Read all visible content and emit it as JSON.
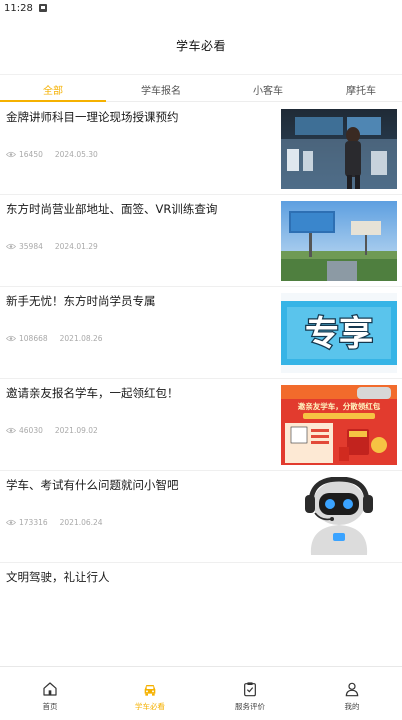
{
  "status_bar": {
    "time": "11:28"
  },
  "header": {
    "title": "学车必看"
  },
  "tabs": [
    {
      "label": "全部",
      "active": true
    },
    {
      "label": "学车报名",
      "active": false
    },
    {
      "label": "小客车",
      "active": false
    },
    {
      "label": "摩托车",
      "active": false
    }
  ],
  "articles": [
    {
      "title": "金牌讲师科目一理论现场授课预约",
      "views": "16450",
      "date": "2024.05.30",
      "thumb": "lecture-photo"
    },
    {
      "title": "东方时尚营业部地址、面签、VR训练查询",
      "views": "35984",
      "date": "2024.01.29",
      "thumb": "billboard-photo"
    },
    {
      "title": "新手无忧！东方时尚学员专属",
      "views": "108668",
      "date": "2021.08.26",
      "thumb": "exclusive-banner",
      "thumb_text": "专享"
    },
    {
      "title": "邀请亲友报名学车，一起领红包！",
      "views": "46030",
      "date": "2021.09.02",
      "thumb": "red-packet-poster",
      "thumb_text": "邀亲友学车，分散领红包"
    },
    {
      "title": "学车、考试有什么问题就问小智吧",
      "views": "173316",
      "date": "2021.06.24",
      "thumb": "robot-assistant"
    },
    {
      "title": "文明驾驶，礼让行人"
    }
  ],
  "bottom_nav": [
    {
      "label": "首页",
      "icon": "home-icon",
      "active": false
    },
    {
      "label": "学车必看",
      "icon": "car-icon",
      "active": true
    },
    {
      "label": "服务评价",
      "icon": "clipboard-check-icon",
      "active": false
    },
    {
      "label": "我的",
      "icon": "user-icon",
      "active": false
    }
  ],
  "colors": {
    "accent": "#f5b100",
    "text": "#1a1a1a",
    "meta": "#a9a9a9",
    "divider": "#efefef"
  }
}
